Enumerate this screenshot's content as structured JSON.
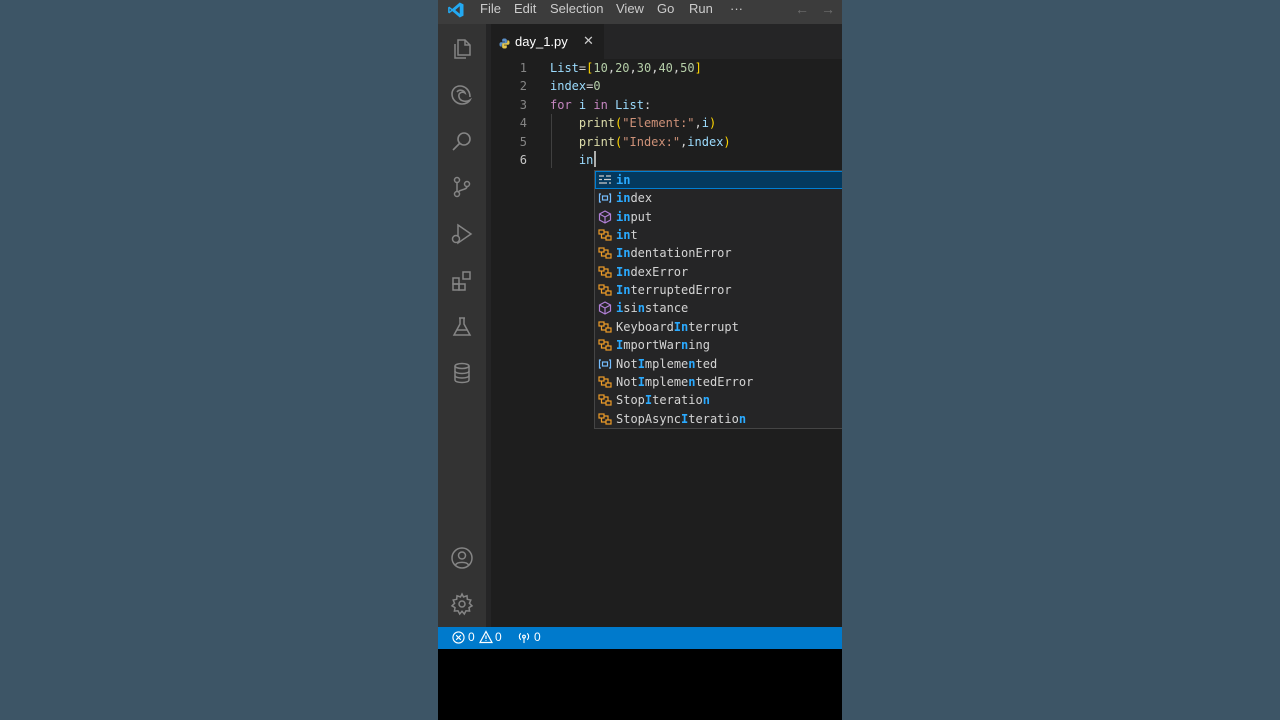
{
  "window": {
    "menu": [
      "File",
      "Edit",
      "Selection",
      "View",
      "Go",
      "Run"
    ],
    "more": "···",
    "nav_back": "←",
    "nav_forward": "→"
  },
  "activity_bar": {
    "items": [
      "explorer-icon",
      "edge-icon",
      "search-icon",
      "source-control-icon",
      "run-debug-icon",
      "extensions-icon",
      "testing-icon",
      "database-icon"
    ],
    "bottom": [
      "account-icon",
      "gear-icon"
    ]
  },
  "tab": {
    "filename": "day_1.py",
    "close": "✕"
  },
  "editor": {
    "line_numbers": [
      "1",
      "2",
      "3",
      "4",
      "5",
      "6"
    ],
    "current_line": "6",
    "lines": [
      [
        [
          "List",
          "var"
        ],
        [
          "=",
          "pun"
        ],
        [
          "[",
          "br"
        ],
        [
          "10",
          "num"
        ],
        [
          ",",
          "pun"
        ],
        [
          "20",
          "num"
        ],
        [
          ",",
          "pun"
        ],
        [
          "30",
          "num"
        ],
        [
          ",",
          "pun"
        ],
        [
          "40",
          "num"
        ],
        [
          ",",
          "pun"
        ],
        [
          "50",
          "num"
        ],
        [
          "]",
          "br"
        ]
      ],
      [
        [
          "index",
          "var"
        ],
        [
          "=",
          "pun"
        ],
        [
          "0",
          "num"
        ]
      ],
      [
        [
          "for",
          "kw"
        ],
        [
          " ",
          "pun"
        ],
        [
          "i",
          "var"
        ],
        [
          " ",
          "pun"
        ],
        [
          "in",
          "kw"
        ],
        [
          " ",
          "pun"
        ],
        [
          "List",
          "var"
        ],
        [
          ":",
          "pun"
        ]
      ],
      [
        [
          "    ",
          "pun"
        ],
        [
          "print",
          "fn"
        ],
        [
          "(",
          "br"
        ],
        [
          "\"Element:\"",
          "str"
        ],
        [
          ",",
          "pun"
        ],
        [
          "i",
          "var"
        ],
        [
          ")",
          "br"
        ]
      ],
      [
        [
          "    ",
          "pun"
        ],
        [
          "print",
          "fn"
        ],
        [
          "(",
          "br"
        ],
        [
          "\"Index:\"",
          "str"
        ],
        [
          ",",
          "pun"
        ],
        [
          "index",
          "var"
        ],
        [
          ")",
          "br"
        ]
      ],
      [
        [
          "    ",
          "pun"
        ],
        [
          "in",
          "var"
        ]
      ]
    ]
  },
  "suggestions": {
    "selected_index": 0,
    "items": [
      {
        "label": "in",
        "icon": "keyword-icon",
        "match": "in"
      },
      {
        "label": "index",
        "icon": "variable-icon",
        "match": "in"
      },
      {
        "label": "input",
        "icon": "function-icon",
        "match": "in"
      },
      {
        "label": "int",
        "icon": "class-icon",
        "match": "in"
      },
      {
        "label": "IndentationError",
        "icon": "class-icon",
        "match": "In"
      },
      {
        "label": "IndexError",
        "icon": "class-icon",
        "match": "In"
      },
      {
        "label": "InterruptedError",
        "icon": "class-icon",
        "match": "In"
      },
      {
        "label": "isinstance",
        "icon": "function-icon",
        "match": "i-n"
      },
      {
        "label": "KeyboardInterrupt",
        "icon": "class-icon",
        "match": "In"
      },
      {
        "label": "ImportWarning",
        "icon": "class-icon",
        "match": "I-n"
      },
      {
        "label": "NotImplemented",
        "icon": "variable-icon",
        "match": "I-n"
      },
      {
        "label": "NotImplementedError",
        "icon": "class-icon",
        "match": "I-n"
      },
      {
        "label": "StopIteration",
        "icon": "class-icon",
        "match": "I-n"
      },
      {
        "label": "StopAsyncIteration",
        "icon": "class-icon",
        "match": "I-n"
      }
    ]
  },
  "status_bar": {
    "errors": "0",
    "warnings": "0",
    "ports": "0"
  },
  "colors": {
    "accent": "#007acc",
    "activity_bar": "#333333",
    "editor_bg": "#1e1e1e",
    "title_bar": "#3c3c3c"
  }
}
